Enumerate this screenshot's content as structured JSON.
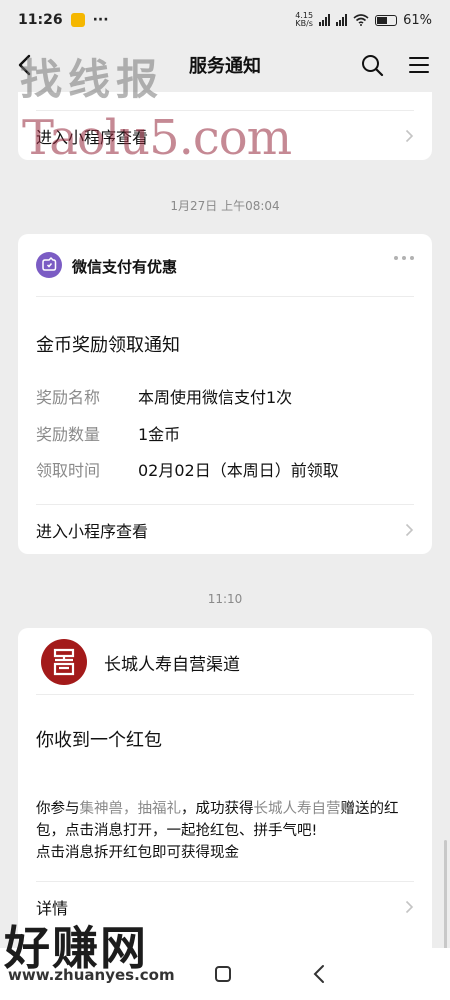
{
  "status_bar": {
    "time": "11:26",
    "dots": "···",
    "net_speed_top": "4.15",
    "net_speed_bottom": "KB/s",
    "battery_level": "61%",
    "battery_fraction": 0.61
  },
  "nav": {
    "title": "服务通知",
    "back_icon": "chevron-left-icon",
    "search_icon": "search-icon",
    "menu_icon": "hamburger-menu-icon"
  },
  "watermarks": {
    "top": "找线报",
    "middle": "Taolu5.com",
    "bottom_main": "好赚网",
    "bottom_url": "www.zhuanyes.com"
  },
  "card_prev": {
    "link_label": "进入小程序查看"
  },
  "message1": {
    "timestamp": "1月27日 上午08:04",
    "sender": "微信支付有优惠",
    "heading": "金币奖励领取通知",
    "rows": [
      {
        "key": "奖励名称",
        "value": "本周使用微信支付1次"
      },
      {
        "key": "奖励数量",
        "value": "1金币"
      },
      {
        "key": "领取时间",
        "value": "02月02日（本周日）前领取"
      }
    ],
    "link_label": "进入小程序查看"
  },
  "message2": {
    "timestamp": "11:10",
    "sender": "长城人寿自营渠道",
    "heading": "你收到一个红包",
    "body_prefix": "你参与",
    "body_hl1": "集神兽，抽福礼",
    "body_mid": "，成功获得",
    "body_hl2": "长城人寿自营",
    "body_suffix": "赠送的红包，点击消息打开，一起抢红包、拼手气吧!",
    "body_line3": "点击消息拆开红包即可获得现金",
    "link_label": "详情"
  },
  "colors": {
    "background": "#ededed",
    "card": "#ffffff",
    "secondary_text": "#8a8a8a",
    "wechat_pay_icon": "#7b5cc4",
    "logo_red": "#a31a1a"
  }
}
